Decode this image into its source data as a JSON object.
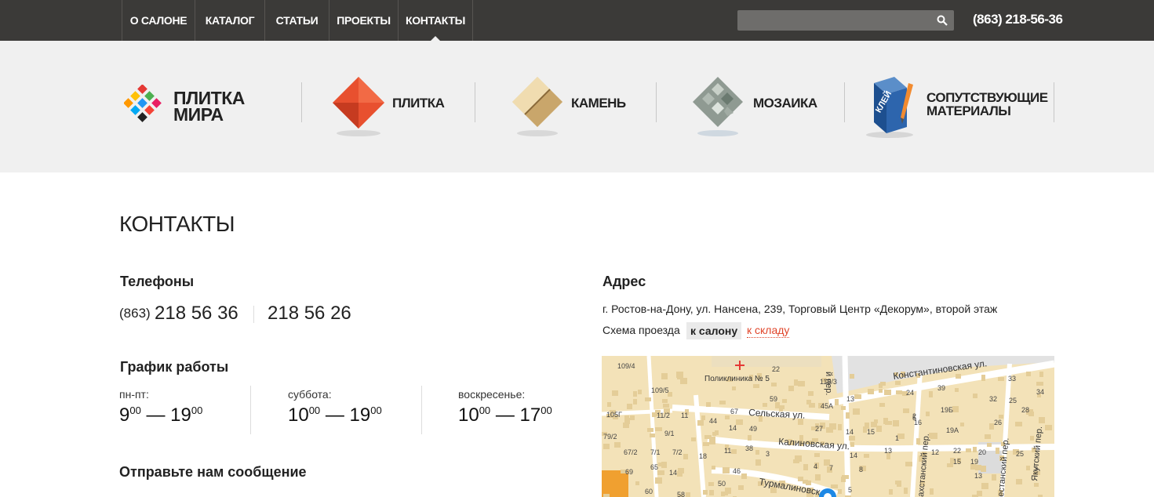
{
  "nav": {
    "items": [
      {
        "label": "О салоне",
        "active": false
      },
      {
        "label": "Каталог",
        "active": false
      },
      {
        "label": "Статьи",
        "active": false
      },
      {
        "label": "Проекты",
        "active": false
      },
      {
        "label": "Контакты",
        "active": true
      }
    ],
    "search_placeholder": "",
    "search_icon": "magnifier-icon",
    "phone": "(863) 218-56-36"
  },
  "brand": {
    "line1": "ПЛИТКА",
    "line2": "МИРА"
  },
  "categories": [
    {
      "label": "Плитка",
      "icon": "red-tile-icon"
    },
    {
      "label": "Камень",
      "icon": "stone-tile-icon"
    },
    {
      "label": "Мозаика",
      "icon": "mosaic-tile-icon"
    },
    {
      "label_line1": "Сопутствующие",
      "label_line2": "материалы",
      "icon": "glue-box-icon"
    }
  ],
  "page": {
    "title": "КОНТАКТЫ"
  },
  "phones": {
    "heading": "Телефоны",
    "code": "(863)",
    "number1": "218 56 36",
    "number2": "218 56 26"
  },
  "schedule": {
    "heading": "График работы",
    "days": [
      {
        "label": "пн-пт:",
        "open_h": "9",
        "open_m": "00",
        "dash": "—",
        "close_h": "19",
        "close_m": "00"
      },
      {
        "label": "суббота:",
        "open_h": "10",
        "open_m": "00",
        "dash": "—",
        "close_h": "19",
        "close_m": "00"
      },
      {
        "label": "воскресенье:",
        "open_h": "10",
        "open_m": "00",
        "dash": "—",
        "close_h": "17",
        "close_m": "00"
      }
    ]
  },
  "message": {
    "heading": "Отправьте нам сообщение"
  },
  "address": {
    "heading": "Адрес",
    "text": "г. Ростов-на-Дону, ул. Нансена, 239, Торговый Центр «Декорум», второй этаж",
    "route_label": "Схема проезда",
    "route_salon": "к салону",
    "route_warehouse": "к складу"
  },
  "map": {
    "streets": [
      "Константиновская ул.",
      "Сельская ул.",
      "Калиновская ул.",
      "Турмалиновск",
      "Якутский пер.",
      "ахстанский пер.",
      "естанский пер.",
      "й пер."
    ],
    "poi": "Поликлиника № 5",
    "house_numbers": [
      "109/4",
      "22",
      "115/3",
      "109/5",
      "59",
      "45А",
      "13",
      "24",
      "39",
      "33",
      "34",
      "105Г",
      "11/2",
      "11",
      "67",
      "5",
      "2",
      "19Б",
      "32",
      "25",
      "28",
      "79/2",
      "9/1",
      "44",
      "14",
      "49",
      "27",
      "14",
      "15",
      "1",
      "16",
      "19А",
      "26",
      "67/2",
      "7/1",
      "7/2",
      "18",
      "11",
      "38",
      "3",
      "14",
      "13",
      "12",
      "22",
      "20",
      "69",
      "65",
      "14",
      "4",
      "7",
      "8",
      "15",
      "19",
      "25",
      "3",
      "46",
      "50",
      "5",
      "13",
      "60",
      "58"
    ],
    "accent": "#f5e6c0"
  },
  "colors": {
    "topbar": "#3b3a38",
    "band": "#f0f0f0",
    "accent_link": "#e0452a"
  }
}
